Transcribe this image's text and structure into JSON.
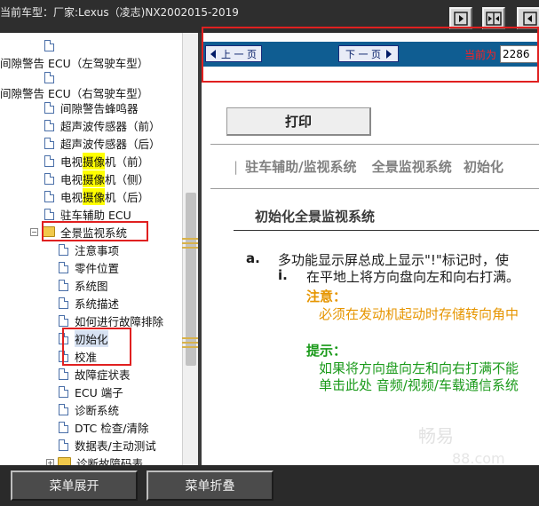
{
  "header": {
    "car_model_label": "当前车型：",
    "car_model_value": "厂家:Lexus（凌志)NX2002015-2019"
  },
  "toolbar_icons": [
    "expand-right-icon",
    "split-view-icon",
    "expand-left-icon"
  ],
  "tree": {
    "items": [
      {
        "label": "间隙警告 ECU（左驾驶车型）",
        "highlight": "",
        "icon": "none"
      },
      {
        "label": "间隙警告 ECU（右驾驶车型）",
        "highlight": "",
        "icon": "none"
      },
      {
        "label": "间隙警告蜂鸣器",
        "icon": "doc"
      },
      {
        "label": "超声波传感器（前）",
        "icon": "doc"
      },
      {
        "label": "超声波传感器（后）",
        "icon": "doc"
      },
      {
        "pre": "电视",
        "highlight": "摄像",
        "post": "机（前）",
        "icon": "doc"
      },
      {
        "pre": "电视",
        "highlight": "摄像",
        "post": "机（侧）",
        "icon": "doc"
      },
      {
        "pre": "电视",
        "highlight": "摄像",
        "post": "机（后）",
        "icon": "doc"
      },
      {
        "label": "驻车辅助 ECU",
        "icon": "doc"
      },
      {
        "label": "全景监视系统",
        "icon": "folder"
      },
      {
        "label": "注意事项",
        "icon": "doc"
      },
      {
        "label": "零件位置",
        "icon": "doc"
      },
      {
        "label": "系统图",
        "icon": "doc"
      },
      {
        "label": "系统描述",
        "icon": "doc"
      },
      {
        "label": "如何进行故障排除",
        "icon": "doc"
      },
      {
        "label": "初始化",
        "icon": "doc",
        "selected": true
      },
      {
        "label": "校准",
        "icon": "doc"
      },
      {
        "label": "故障症状表",
        "icon": "doc"
      },
      {
        "label": "ECU 端子",
        "icon": "doc"
      },
      {
        "label": "诊断系统",
        "icon": "doc"
      },
      {
        "label": "DTC 检查/清除",
        "icon": "doc"
      },
      {
        "label": "数据表/主动测试",
        "icon": "doc"
      },
      {
        "label": "诊断故障码表",
        "icon": "folder"
      }
    ]
  },
  "nav": {
    "prev_label": "上 一 页",
    "next_label": "下 一 页",
    "current_label": "当前为",
    "current_value": "2286"
  },
  "content": {
    "print_label": "打印",
    "breadcrumb": [
      "驻车辅助/监视系统",
      "全景监视系统",
      "初始化"
    ],
    "section_title": "初始化全景监视系统",
    "step_a_marker": "a.",
    "step_a_text": "多功能显示屏总成上显示\"!\"标记时，使",
    "step_i_marker": "i.",
    "step_i_text": "在平地上将方向盘向左和向右打满。",
    "caution_head": "注意：",
    "caution_text": "必须在发动机起动时存储转向角中",
    "hint_head": "提示：",
    "hint_line1": "如果将方向盘向左和向右打满不能",
    "hint_line2": "单击此处 音频/视频/车载通信系统",
    "watermark": "畅易",
    "watermark2": "88.com",
    "colors": {
      "caution": "#e69500",
      "hint": "#1a9a1a"
    }
  },
  "bottom": {
    "expand_label": "菜单展开",
    "collapse_label": "菜单折叠"
  }
}
